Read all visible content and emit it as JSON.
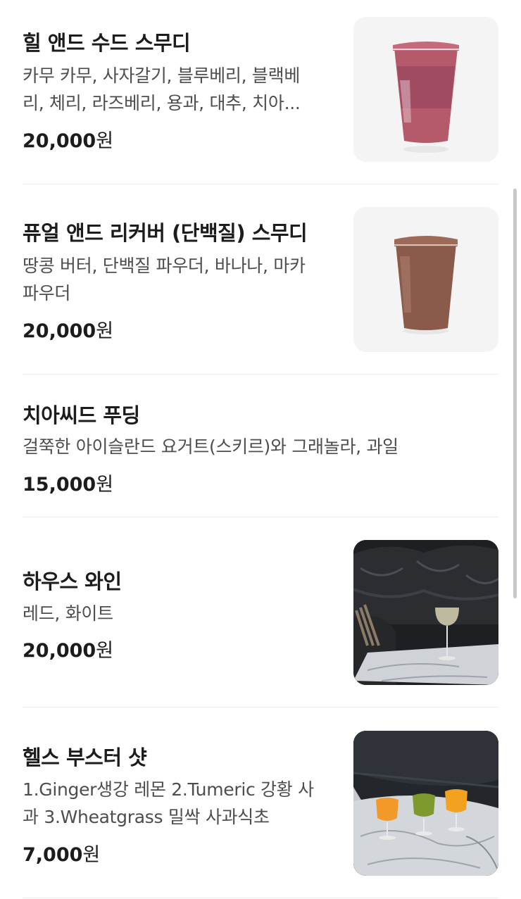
{
  "menu": {
    "items": [
      {
        "title": "힐 앤드 수드 스무디",
        "description_lines": [
          "카무 카무, 사자갈기, 블루베리, 블랙베",
          "리, 체리, 라즈베리, 용과, 대추, 치아..."
        ],
        "price": "20,000",
        "currency": "원",
        "image": "berry-smoothie-photo"
      },
      {
        "title": "퓨얼 앤드 리커버 (단백질) 스무디",
        "description_lines": [
          "땅콩 버터, 단백질 파우더, 바나나, 마카",
          "파우더"
        ],
        "price": "20,000",
        "currency": "원",
        "image": "protein-smoothie-photo"
      },
      {
        "title": "치아씨드 푸딩",
        "description_lines": [
          "걸쭉한 아이슬란드 요거트(스키르)와 그래놀라, 과일"
        ],
        "price": "15,000",
        "currency": "원"
      },
      {
        "title": "하우스 와인",
        "description_lines": [
          "레드, 화이트"
        ],
        "price": "20,000",
        "currency": "원",
        "image": "wine-glass-photo"
      },
      {
        "title": "헬스 부스터 샷",
        "description_lines": [
          "1.Ginger생강 레몬 2.Tumeric 강황 사",
          "과 3.Wheatgrass 밀싹 사과식초"
        ],
        "price": "7,000",
        "currency": "원",
        "image": "booster-shots-photo"
      }
    ]
  },
  "colors": {
    "text_primary": "#1c1c1c",
    "text_secondary": "#4d4d4d",
    "divider": "#ececec",
    "thumb_background": "#f4f4f4"
  }
}
